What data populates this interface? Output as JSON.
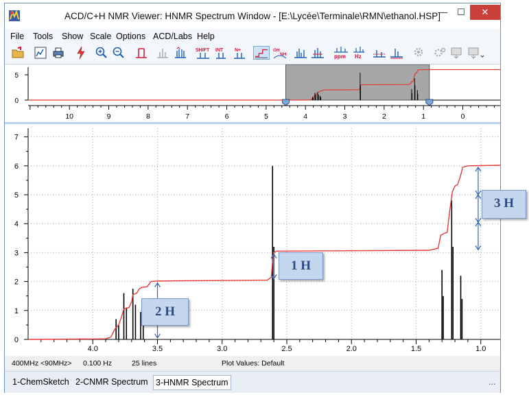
{
  "window": {
    "title": "ACD/C+H NMR Viewer: HNMR Spectrum Window - [E:\\Lycée\\Terminale\\RMN\\ethanol.HSP]",
    "minimize_glyph": "—",
    "maximize_glyph": "☐",
    "close_glyph": "✕"
  },
  "menu": {
    "items": [
      "File",
      "Tools",
      "Show",
      "Scale",
      "Options",
      "ACD/Labs",
      "Help"
    ]
  },
  "toolbar": {
    "icons": [
      "open-icon",
      "chart-icon",
      "print-icon",
      "lightning-icon",
      "zoom-in-icon",
      "zoom-out-icon",
      "peak-icon",
      "peak-gray-icon",
      "multiplet-icon",
      "shift-icon",
      "int-icon",
      "nplus-icon",
      "integral-curve-icon",
      "oh-nh-icon",
      "spectrum-icon",
      "spectrum-alt-icon",
      "ppm-icon",
      "hz-icon",
      "baseline-icon",
      "baseline-alt-icon",
      "gear-gray-icon",
      "gear-gray2-icon",
      "export-gray-icon",
      "export-gray2-icon"
    ],
    "labels": {
      "shift": "SHIFT",
      "int": "INT",
      "nplus": "N+",
      "oh": "OH",
      "nh": "NH",
      "ppm": "ppm",
      "hz": "Hz"
    }
  },
  "overview": {
    "y_ticks": [
      "5",
      "0"
    ],
    "x_ticks": [
      "10",
      "9",
      "8",
      "7",
      "6",
      "5",
      "4",
      "3",
      "2",
      "1",
      "0"
    ]
  },
  "chart_data": {
    "type": "line",
    "title": "",
    "xlabel": "",
    "ylabel": "",
    "x_unit": "ppm",
    "xlim": [
      4.5,
      0.85
    ],
    "ylim": [
      0,
      7.3
    ],
    "x_ticks": [
      "4.0",
      "3.5",
      "3.0",
      "2.5",
      "2.0",
      "1.5",
      "1.0"
    ],
    "y_ticks": [
      "0",
      "1",
      "2",
      "3",
      "4",
      "5",
      "6",
      "7"
    ],
    "grid": true,
    "series": [
      {
        "kind": "peaks",
        "color": "#000000",
        "peaks": [
          {
            "x": 3.82,
            "y": 0.7
          },
          {
            "x": 3.8,
            "y": 0.5
          },
          {
            "x": 3.76,
            "y": 1.6
          },
          {
            "x": 3.74,
            "y": 1.1
          },
          {
            "x": 3.69,
            "y": 1.75
          },
          {
            "x": 3.67,
            "y": 1.2
          },
          {
            "x": 3.63,
            "y": 0.95
          },
          {
            "x": 3.61,
            "y": 0.7
          },
          {
            "x": 2.61,
            "y": 6.0
          },
          {
            "x": 2.6,
            "y": 3.2
          },
          {
            "x": 1.3,
            "y": 2.4
          },
          {
            "x": 1.29,
            "y": 1.5
          },
          {
            "x": 1.225,
            "y": 4.8
          },
          {
            "x": 1.215,
            "y": 3.2
          },
          {
            "x": 1.155,
            "y": 2.2
          },
          {
            "x": 1.145,
            "y": 1.4
          }
        ]
      },
      {
        "kind": "integral",
        "color": "#e53935",
        "points": [
          [
            4.5,
            0.0
          ],
          [
            3.9,
            0.02
          ],
          [
            3.86,
            0.08
          ],
          [
            3.83,
            0.35
          ],
          [
            3.8,
            0.5
          ],
          [
            3.78,
            0.75
          ],
          [
            3.76,
            1.05
          ],
          [
            3.72,
            1.1
          ],
          [
            3.7,
            1.3
          ],
          [
            3.69,
            1.55
          ],
          [
            3.66,
            1.6
          ],
          [
            3.64,
            1.75
          ],
          [
            3.62,
            1.8
          ],
          [
            3.58,
            1.82
          ],
          [
            3.55,
            2.0
          ],
          [
            3.5,
            2.02
          ],
          [
            2.65,
            2.05
          ],
          [
            2.62,
            2.15
          ],
          [
            2.61,
            2.7
          ],
          [
            2.6,
            3.0
          ],
          [
            2.58,
            3.05
          ],
          [
            1.4,
            3.08
          ],
          [
            1.33,
            3.15
          ],
          [
            1.31,
            3.6
          ],
          [
            1.29,
            3.65
          ],
          [
            1.26,
            3.7
          ],
          [
            1.24,
            4.45
          ],
          [
            1.22,
            5.1
          ],
          [
            1.2,
            5.3
          ],
          [
            1.18,
            5.35
          ],
          [
            1.16,
            5.6
          ],
          [
            1.14,
            5.95
          ],
          [
            1.1,
            6.0
          ],
          [
            0.85,
            6.02
          ]
        ]
      }
    ],
    "annotations": [
      {
        "label": "2 H",
        "x_from": 3.5,
        "y_from": 0.05,
        "y_to": 1.95
      },
      {
        "label": "1 H",
        "x_from": 2.6,
        "y_from": 2.1,
        "y_to": 2.95
      },
      {
        "label": "3 H",
        "x_from": 1.02,
        "y_from": 3.1,
        "y_to": 5.95
      }
    ]
  },
  "status": {
    "freq": "400MHz <90MHz>",
    "hz": "0.100 Hz",
    "lines": "25 lines",
    "plot_values": "Plot Values: Default"
  },
  "tabs": [
    {
      "label": "1-ChemSketch",
      "active": false
    },
    {
      "label": "2-CNMR Spectrum",
      "active": false
    },
    {
      "label": "3-HNMR Spectrum",
      "active": true
    }
  ],
  "tabs_more": "..."
}
